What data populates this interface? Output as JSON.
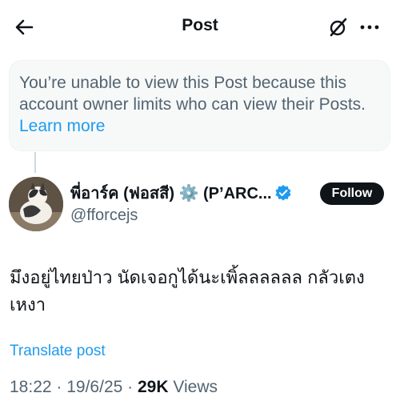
{
  "header": {
    "title": "Post",
    "back_icon": "arrow-left-icon",
    "grok_icon": "grok-icon",
    "more_icon": "more-horizontal-icon"
  },
  "notice": {
    "text": "You’re unable to view this Post because this account owner limits who can view their Posts.",
    "link": "Learn more"
  },
  "author": {
    "display_name": "พี่อาร์ค (ฟอสสี) ⚙️ (P’ARC...",
    "handle": "@fforcejs",
    "verified": true,
    "follow_label": "Follow"
  },
  "tweet": {
    "text": "มึงอยู่ไทยป่าว นัดเจอกูได้นะเพิ้ลลลลลล กลัวเตงเหงา",
    "translate_label": "Translate post",
    "time": "18:22",
    "date": "19/6/25",
    "views_count": "29K",
    "views_label": "Views"
  },
  "colors": {
    "accent": "#1d9bf0",
    "text": "#0f1419",
    "secondary": "#536471"
  }
}
